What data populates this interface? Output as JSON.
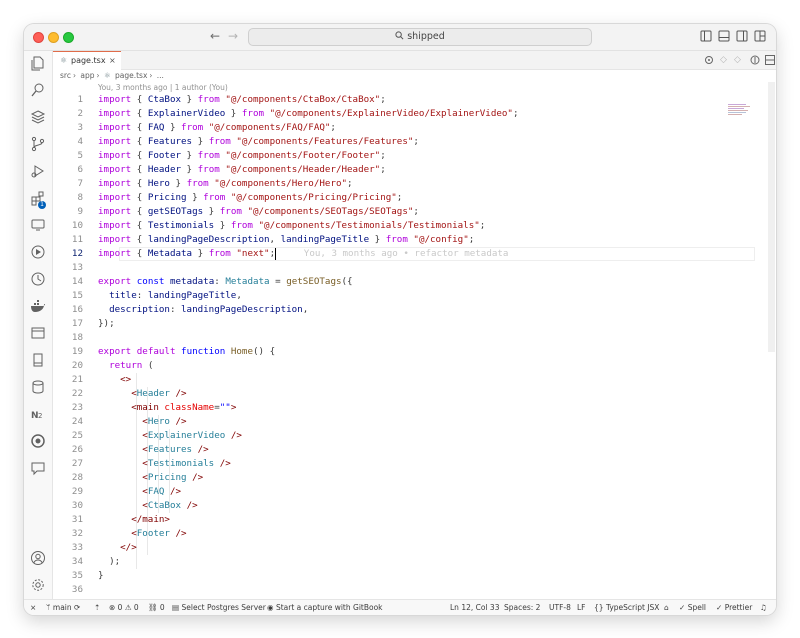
{
  "titlebar": {
    "search_text": "shipped",
    "back_arrow": "←",
    "forward_arrow": "→"
  },
  "tab": {
    "label": "page.tsx",
    "close": "×"
  },
  "breadcrumb": [
    "src",
    "app",
    "page.tsx",
    "..."
  ],
  "blame_header": "You, 3 months ago | 1 author (You)",
  "code": {
    "lines": [
      {
        "n": "1",
        "html": "<span class='kw'>import</span> { <span class='var'>CtaBox</span> } <span class='kw'>from</span> <span class='str'>\"@/components/CtaBox/CtaBox\"</span>;"
      },
      {
        "n": "2",
        "html": "<span class='kw'>import</span> { <span class='var'>ExplainerVideo</span> } <span class='kw'>from</span> <span class='str'>\"@/components/ExplainerVideo/ExplainerVideo\"</span>;"
      },
      {
        "n": "3",
        "html": "<span class='kw'>import</span> { <span class='var'>FAQ</span> } <span class='kw'>from</span> <span class='str'>\"@/components/FAQ/FAQ\"</span>;"
      },
      {
        "n": "4",
        "html": "<span class='kw'>import</span> { <span class='var'>Features</span> } <span class='kw'>from</span> <span class='str'>\"@/components/Features/Features\"</span>;"
      },
      {
        "n": "5",
        "html": "<span class='kw'>import</span> { <span class='var'>Footer</span> } <span class='kw'>from</span> <span class='str'>\"@/components/Footer/Footer\"</span>;"
      },
      {
        "n": "6",
        "html": "<span class='kw'>import</span> { <span class='var'>Header</span> } <span class='kw'>from</span> <span class='str'>\"@/components/Header/Header\"</span>;"
      },
      {
        "n": "7",
        "html": "<span class='kw'>import</span> { <span class='var'>Hero</span> } <span class='kw'>from</span> <span class='str'>\"@/components/Hero/Hero\"</span>;"
      },
      {
        "n": "8",
        "html": "<span class='kw'>import</span> { <span class='var'>Pricing</span> } <span class='kw'>from</span> <span class='str'>\"@/components/Pricing/Pricing\"</span>;"
      },
      {
        "n": "9",
        "html": "<span class='kw'>import</span> { <span class='var'>getSEOTags</span> } <span class='kw'>from</span> <span class='str'>\"@/components/SEOTags/SEOTags\"</span>;"
      },
      {
        "n": "10",
        "html": "<span class='kw'>import</span> { <span class='var'>Testimonials</span> } <span class='kw'>from</span> <span class='str'>\"@/components/Testimonials/Testimonials\"</span>;"
      },
      {
        "n": "11",
        "html": "<span class='kw'>import</span> { <span class='var'>landingPageDescription</span>, <span class='var'>landingPageTitle</span> } <span class='kw'>from</span> <span class='str'>\"@/config\"</span>;"
      },
      {
        "n": "12",
        "html": "<span class='kw'>import</span> { <span class='var'>Metadata</span> } <span class='kw'>from</span> <span class='str'>\"next\"</span>;<span class='caret'></span>     <span class='ghost'>You, 3 months ago • refactor metadata</span>"
      },
      {
        "n": "13",
        "html": ""
      },
      {
        "n": "14",
        "html": "<span class='kw'>export</span> <span class='kw2'>const</span> <span class='var'>metadata</span>: <span class='cls'>Metadata</span> = <span class='fn'>getSEOTags</span>({"
      },
      {
        "n": "15",
        "html": "  <span class='var'>title</span>: <span class='var'>landingPageTitle</span>,"
      },
      {
        "n": "16",
        "html": "  <span class='var'>description</span>: <span class='var'>landingPageDescription</span>,"
      },
      {
        "n": "17",
        "html": "});"
      },
      {
        "n": "18",
        "html": ""
      },
      {
        "n": "19",
        "html": "<span class='kw'>export</span> <span class='kw'>default</span> <span class='kw2'>function</span> <span class='fn'>Home</span>() {"
      },
      {
        "n": "20",
        "html": "  <span class='kw'>return</span> ("
      },
      {
        "n": "21",
        "html": "    <span class='tag'>&lt;&gt;</span>"
      },
      {
        "n": "22",
        "html": "      <span class='tag'>&lt;</span><span class='cls'>Header</span> <span class='tag'>/&gt;</span>"
      },
      {
        "n": "23",
        "html": "      <span class='tag'>&lt;main</span> <span class='attr'>className</span>=<span class='kw2'>\"\"</span><span class='tag'>&gt;</span>"
      },
      {
        "n": "24",
        "html": "        <span class='tag'>&lt;</span><span class='cls'>Hero</span> <span class='tag'>/&gt;</span>"
      },
      {
        "n": "25",
        "html": "        <span class='tag'>&lt;</span><span class='cls'>ExplainerVideo</span> <span class='tag'>/&gt;</span>"
      },
      {
        "n": "26",
        "html": "        <span class='tag'>&lt;</span><span class='cls'>Features</span> <span class='tag'>/&gt;</span>"
      },
      {
        "n": "27",
        "html": "        <span class='tag'>&lt;</span><span class='cls'>Testimonials</span> <span class='tag'>/&gt;</span>"
      },
      {
        "n": "28",
        "html": "        <span class='tag'>&lt;</span><span class='cls'>Pricing</span> <span class='tag'>/&gt;</span>"
      },
      {
        "n": "29",
        "html": "        <span class='tag'>&lt;</span><span class='cls'>FAQ</span> <span class='tag'>/&gt;</span>"
      },
      {
        "n": "30",
        "html": "        <span class='tag'>&lt;</span><span class='cls'>CtaBox</span> <span class='tag'>/&gt;</span>"
      },
      {
        "n": "31",
        "html": "      <span class='tag'>&lt;/main&gt;</span>"
      },
      {
        "n": "32",
        "html": "      <span class='tag'>&lt;</span><span class='cls'>Footer</span> <span class='tag'>/&gt;</span>"
      },
      {
        "n": "33",
        "html": "    <span class='tag'>&lt;/&gt;</span>"
      },
      {
        "n": "34",
        "html": "  );"
      },
      {
        "n": "35",
        "html": "}"
      },
      {
        "n": "36",
        "html": ""
      }
    ],
    "active_line": "12"
  },
  "statusbar": {
    "branch": "main",
    "problems": "⊗ 0 ⚠ 0",
    "ports": "0",
    "postgres": "Select Postgres Server",
    "gitbook": "Start a capture with GitBook",
    "position": "Ln 12, Col 33",
    "spaces": "Spaces: 2",
    "encoding": "UTF-8",
    "eol": "LF",
    "language": "TypeScript JSX",
    "spell": "Spell",
    "prettier": "Prettier"
  },
  "activity_badge": "1",
  "colors": {
    "keyword": "#af00db",
    "string": "#a31515",
    "variable": "#001080",
    "type": "#267f99",
    "function": "#795e26",
    "tab_accent": "#e06c4a"
  }
}
